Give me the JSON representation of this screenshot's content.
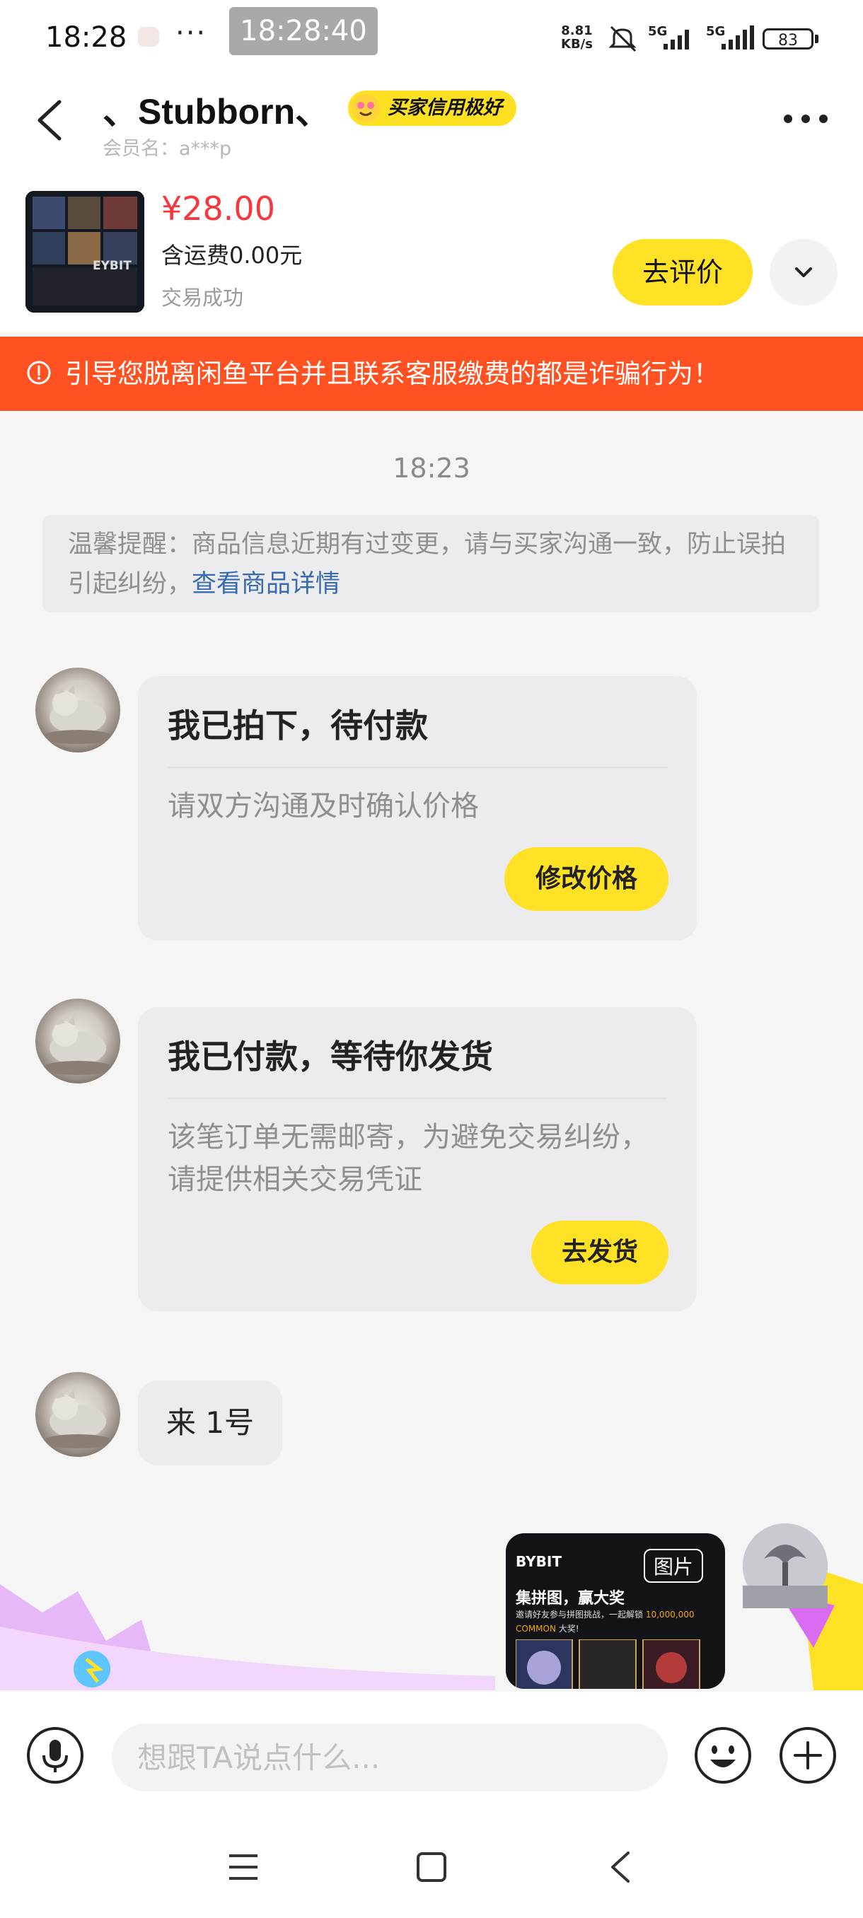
{
  "status_bar": {
    "time": "18:28",
    "dots": "···",
    "overlay_time": "18:28:40",
    "net_speed_value": "8.81",
    "net_speed_unit": "KB/s",
    "network_1": "5G",
    "network_2": "5G",
    "battery": "83"
  },
  "header": {
    "seller_name": "、Stubborn、",
    "credit_badge": "买家信用极好",
    "member_label": "会员名：a***p"
  },
  "order": {
    "price": "¥28.00",
    "shipping": "含运费0.00元",
    "status": "交易成功",
    "review_button": "去评价",
    "thumb_brand": "EYBIT"
  },
  "warning": {
    "text": "引导您脱离闲鱼平台并且联系客服缴费的都是诈骗行为！"
  },
  "chat": {
    "timestamp": "18:23",
    "tip_text": "温馨提醒：商品信息近期有过变更，请与买家沟通一致，防止误拍引起纠纷，",
    "tip_link": "查看商品详情",
    "card1": {
      "title": "我已拍下，待付款",
      "body": "请双方沟通及时确认价格",
      "button": "修改价格"
    },
    "card2": {
      "title": "我已付款，等待你发货",
      "body": "该笔订单无需邮寄，为避免交易纠纷，请提供相关交易凭证",
      "button": "去发货"
    },
    "message": "来 1号",
    "promo": {
      "brand": "BYBIT",
      "tag": "图片",
      "title": "集拼图，赢大奖",
      "subtitle": "邀请好友参与拼图挑战，一起解锁",
      "amount": "10,000,000",
      "common": "COMMON",
      "prize": "大奖!"
    }
  },
  "input": {
    "placeholder": "想跟TA说点什么..."
  },
  "colors": {
    "accent_yellow": "#ffe125",
    "warning_orange": "#ff5121",
    "price_red": "#f5383c",
    "link_blue": "#376bb0"
  }
}
